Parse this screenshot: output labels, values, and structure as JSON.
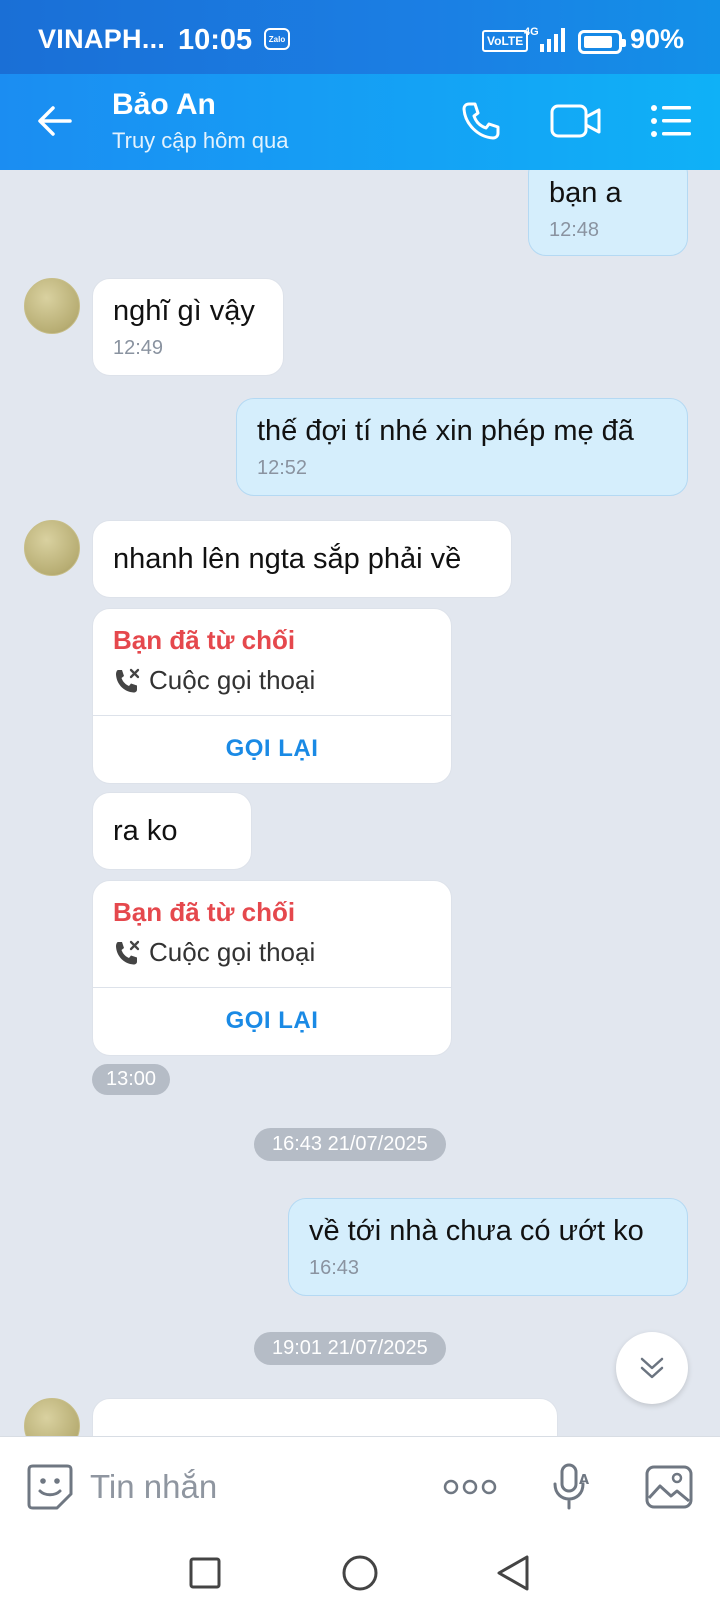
{
  "status_bar": {
    "carrier": "VINAPH...",
    "time": "10:05",
    "app_badge": "Zalo",
    "volte": "VoLTE",
    "network": "4G",
    "battery_percent": "90%",
    "battery_level": 0.9
  },
  "header": {
    "contact_name": "Bảo An",
    "last_seen": "Truy cập hôm qua",
    "icons": [
      "back-arrow-icon",
      "phone-icon",
      "video-camera-icon",
      "menu-list-icon"
    ]
  },
  "messages": [
    {
      "direction": "out",
      "text": "bạn a",
      "time": "12:48"
    },
    {
      "direction": "in",
      "text": "nghĩ gì vậy",
      "time": "12:49"
    },
    {
      "direction": "out",
      "text": "thế đợi tí nhé xin phép mẹ đã",
      "time": "12:52"
    },
    {
      "direction": "in",
      "text": "nhanh lên ngta sắp phải về"
    },
    {
      "direction": "in",
      "type": "call",
      "status": "Bạn đã từ chối",
      "call_type": "Cuộc gọi thoại",
      "action": "GỌI LẠI"
    },
    {
      "direction": "in",
      "text": "ra ko"
    },
    {
      "direction": "in",
      "type": "call",
      "status": "Bạn đã từ chối",
      "call_type": "Cuộc gọi thoại",
      "action": "GỌI LẠI",
      "time": "13:00"
    },
    {
      "type": "date_separator",
      "label": "16:43 21/07/2025"
    },
    {
      "direction": "out",
      "text": "về tới nhà chưa có ướt ko",
      "time": "16:43"
    },
    {
      "type": "date_separator",
      "label": "19:01 21/07/2025"
    }
  ],
  "input_bar": {
    "placeholder": "Tin nhắn",
    "icons": [
      "sticker-emoji-icon",
      "more-dots-icon",
      "voice-mic-icon",
      "image-gallery-icon"
    ]
  },
  "nav_bar": {
    "icons": [
      "recent-apps-icon",
      "home-icon",
      "back-triangle-icon"
    ]
  },
  "colors": {
    "header_gradient_start": "#1b8df2",
    "header_gradient_end": "#0fb1f7",
    "chat_background": "#e2e7ef",
    "outgoing_bubble": "#d5eefc",
    "incoming_bubble": "#ffffff",
    "declined_call_text": "#e5484d",
    "recall_text": "#1a8ae5"
  }
}
